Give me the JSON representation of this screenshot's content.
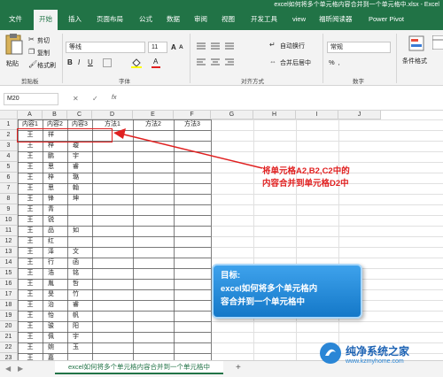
{
  "window": {
    "doc_title": "excel如何将多个单元格内容合并到一个单元格中.xlsx - Excel"
  },
  "tabs": [
    "文件",
    "开始",
    "插入",
    "页面布局",
    "公式",
    "数据",
    "审阅",
    "视图",
    "开发工具",
    "view",
    "福昕阅读器",
    "Power Pivot"
  ],
  "active_tab": "开始",
  "ribbon": {
    "paste": "粘贴",
    "cut": "剪切",
    "copy": "复制",
    "format_painter": "格式刷",
    "clipboard_group": "剪贴板",
    "font_name": "等线",
    "font_size": "11",
    "font_group": "字体",
    "wrap_text": "自动换行",
    "merge_center": "合并后居中",
    "alignment_group": "对齐方式",
    "number_format": "常规",
    "number_group": "数字",
    "conditional_format": "条件格式",
    "bold": "B",
    "italic": "I",
    "underline": "U",
    "grow_font": "A",
    "shrink_font": "A",
    "font_color_letter": "A"
  },
  "formula_bar": {
    "name_box": "M20",
    "fx": "fx",
    "value": ""
  },
  "columns": [
    "A",
    "B",
    "C",
    "D",
    "E",
    "F",
    "G",
    "H",
    "I",
    "J"
  ],
  "rows": [
    [
      "内容1",
      "内容2",
      "内容3",
      "方法1",
      "方法2",
      "方法3"
    ],
    [
      "王",
      "祥",
      "",
      "",
      "",
      ""
    ],
    [
      "王",
      "梓",
      "璇",
      "",
      "",
      ""
    ],
    [
      "王",
      "鹏",
      "宇",
      "",
      "",
      ""
    ],
    [
      "王",
      "思",
      "睿",
      "",
      "",
      ""
    ],
    [
      "王",
      "梓",
      "璐",
      "",
      "",
      ""
    ],
    [
      "王",
      "思",
      "翰",
      "",
      "",
      ""
    ],
    [
      "王",
      "锋",
      "坤",
      "",
      "",
      ""
    ],
    [
      "王",
      "青",
      "",
      "",
      "",
      ""
    ],
    [
      "王",
      "锐",
      "",
      "",
      "",
      ""
    ],
    [
      "王",
      "品",
      "如",
      "",
      "",
      ""
    ],
    [
      "王",
      "红",
      "",
      "",
      "",
      ""
    ],
    [
      "王",
      "泽",
      "文",
      "",
      "",
      ""
    ],
    [
      "王",
      "行",
      "函",
      "",
      "",
      ""
    ],
    [
      "王",
      "浩",
      "铭",
      "",
      "",
      ""
    ],
    [
      "王",
      "胤",
      "哲",
      "",
      "",
      ""
    ],
    [
      "王",
      "旻",
      "竹",
      "",
      "",
      ""
    ],
    [
      "王",
      "治",
      "睿",
      "",
      "",
      ""
    ],
    [
      "王",
      "怡",
      "帆",
      "",
      "",
      ""
    ],
    [
      "王",
      "骏",
      "阳",
      "",
      "",
      ""
    ],
    [
      "王",
      "佩",
      "宇",
      "",
      "",
      ""
    ],
    [
      "王",
      "婉",
      "玉",
      "",
      "",
      ""
    ],
    [
      "王",
      "嘉",
      "",
      "",
      "",
      ""
    ]
  ],
  "annotation": {
    "line1": "将单元格A2,B2,C2中的",
    "line2": "内容合并到单元格D2中"
  },
  "goal_box": {
    "title": "目标:",
    "line1": "excel如何将多个单元格内",
    "line2": "容合并到一个单元格中"
  },
  "sheet_tab": "excel如何将多个单元格内容合并到一个单元格中",
  "add_sheet": "+",
  "watermark": {
    "name": "纯净系统之家",
    "url": "www.kzmyhome.com"
  },
  "colors": {
    "excel_green": "#217346",
    "annotation_red": "#e02020",
    "goal_blue": "#1a8de0"
  }
}
